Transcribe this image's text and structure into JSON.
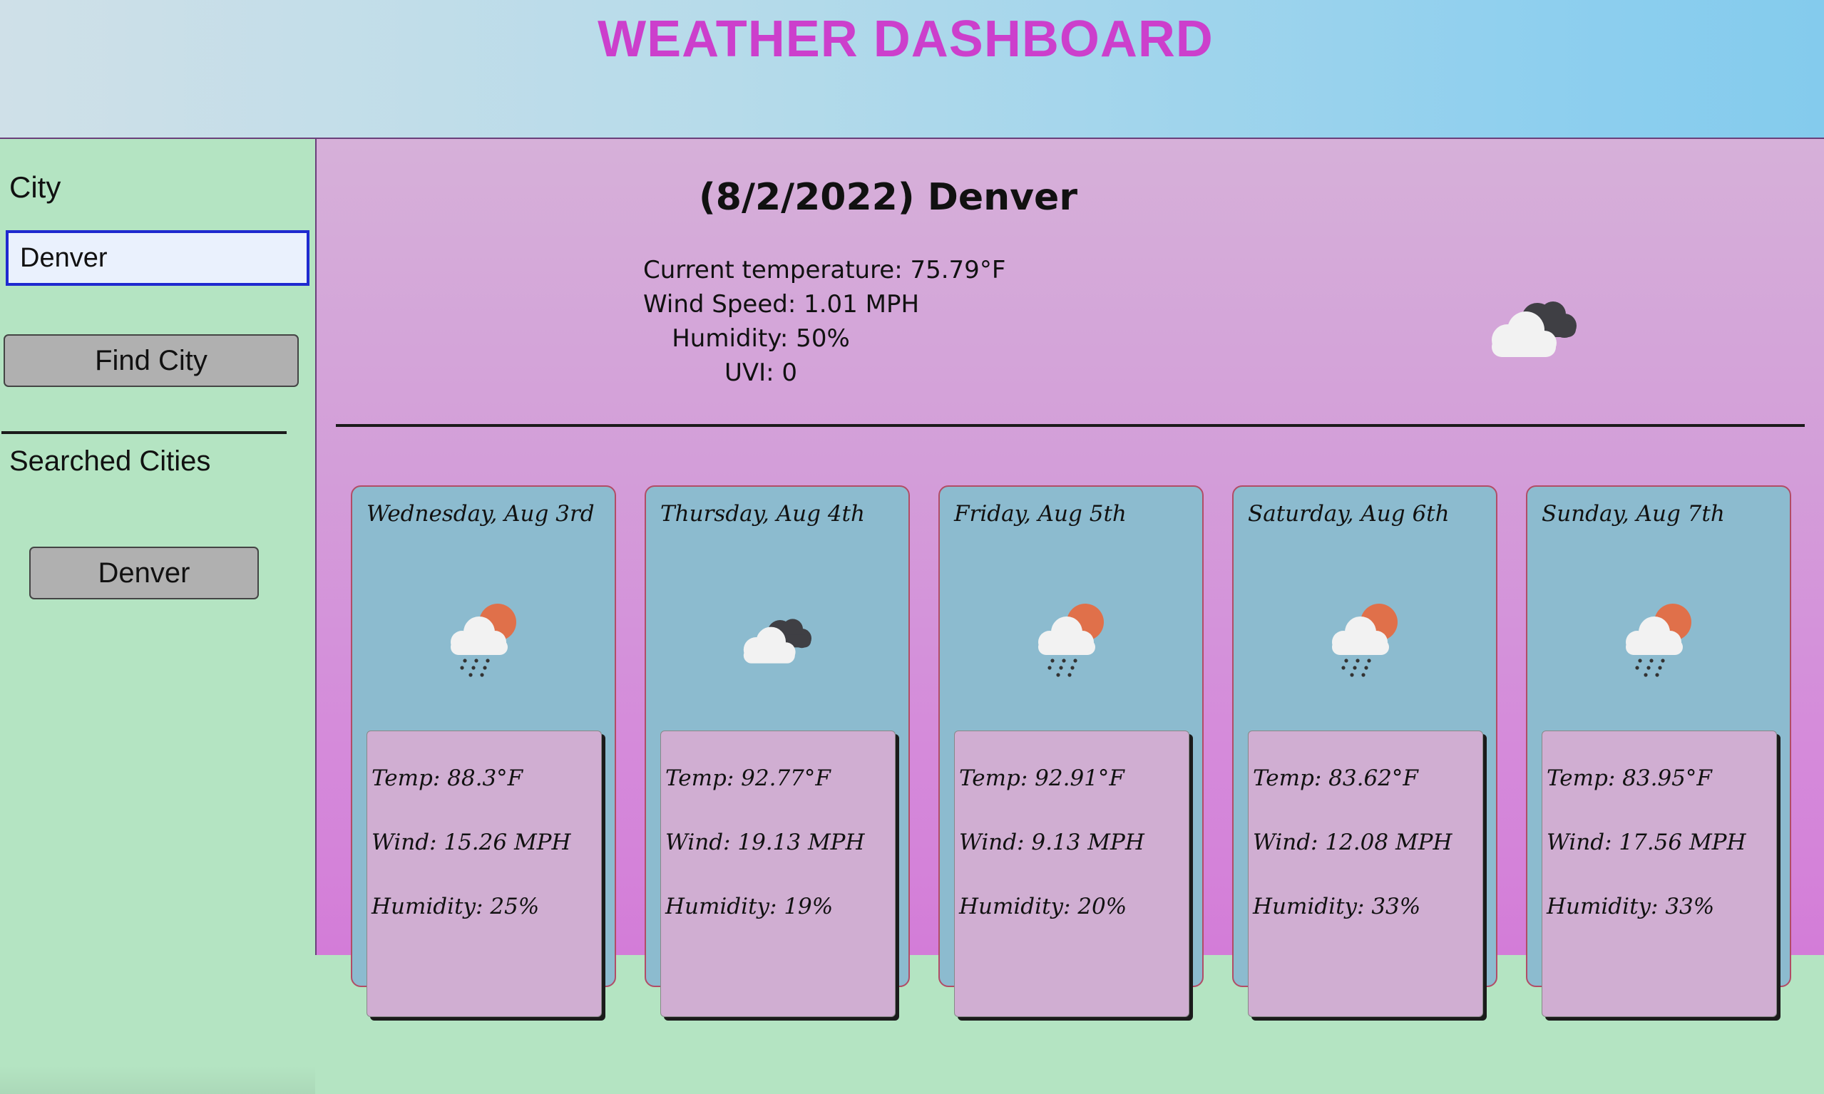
{
  "header": {
    "title": "WEATHER DASHBOARD"
  },
  "sidebar": {
    "city_label": "City",
    "city_input_value": "Denver",
    "find_button_label": "Find City",
    "searched_label": "Searched Cities",
    "history": [
      "Denver"
    ]
  },
  "current": {
    "heading": "(8/2/2022) Denver",
    "temperature": "Current temperature: 75.79°F",
    "wind": "Wind Speed: 1.01 MPH",
    "humidity": "Humidity: 50%",
    "uvi": "UVI: 0",
    "icon": "broken-clouds-icon"
  },
  "forecast": [
    {
      "day": "Wednesday, Aug 3rd",
      "icon": "rain-icon",
      "temp": "Temp: 88.3°F",
      "wind": "Wind: 15.26 MPH",
      "humidity": "Humidity: 25%"
    },
    {
      "day": "Thursday, Aug 4th",
      "icon": "broken-clouds-icon",
      "temp": "Temp: 92.77°F",
      "wind": "Wind: 19.13 MPH",
      "humidity": "Humidity: 19%"
    },
    {
      "day": "Friday, Aug 5th",
      "icon": "rain-icon",
      "temp": "Temp: 92.91°F",
      "wind": "Wind: 9.13 MPH",
      "humidity": "Humidity: 20%"
    },
    {
      "day": "Saturday, Aug 6th",
      "icon": "rain-icon",
      "temp": "Temp: 83.62°F",
      "wind": "Wind: 12.08 MPH",
      "humidity": "Humidity: 33%"
    },
    {
      "day": "Sunday, Aug 7th",
      "icon": "rain-icon",
      "temp": "Temp: 83.95°F",
      "wind": "Wind: 17.56 MPH",
      "humidity": "Humidity: 33%"
    }
  ],
  "colors": {
    "title": "#cc3fcc",
    "sidebar_bg": "#b4e4c2",
    "card_bg": "#8cbbcf",
    "stat_box_bg": "#d0aed2",
    "input_border": "#1f2ad0",
    "sun": "#e0704a"
  }
}
